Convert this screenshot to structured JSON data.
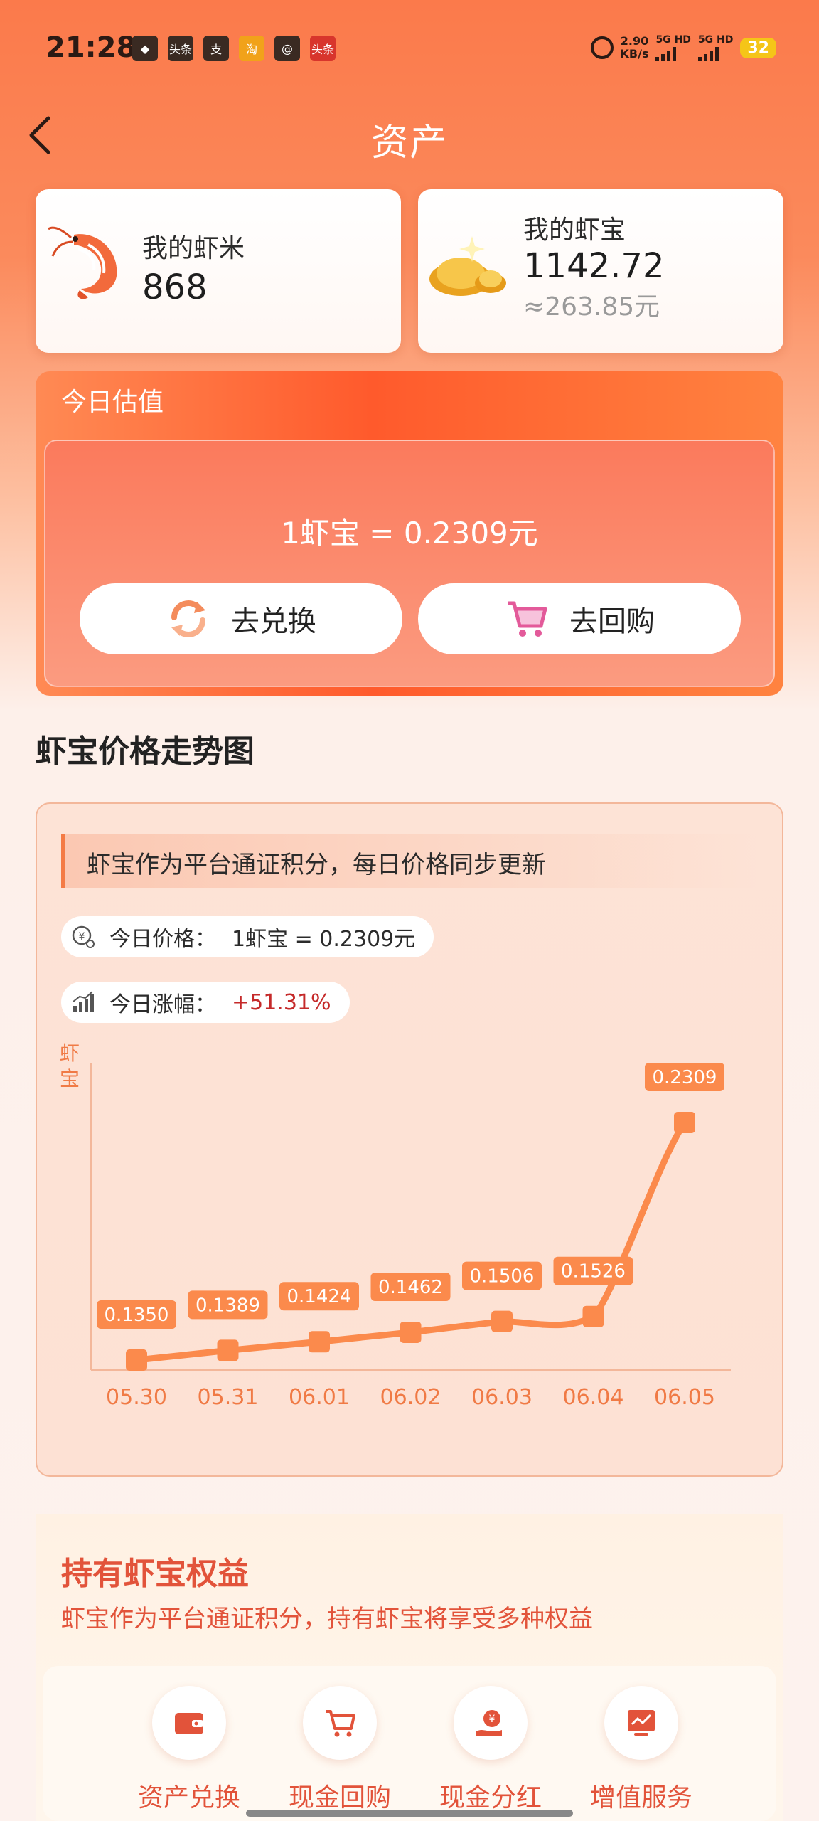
{
  "status_bar": {
    "time": "21:28",
    "apps": [
      "头条",
      "支",
      "淘",
      "@",
      "头条"
    ],
    "speed_value": "2.90",
    "speed_unit": "KB/s",
    "net1": "5G HD",
    "net2": "5G HD",
    "battery": "32"
  },
  "header": {
    "title": "资产"
  },
  "cards": {
    "shrimp": {
      "label": "我的虾米",
      "value": "868"
    },
    "treasure": {
      "label": "我的虾宝",
      "value": "1142.72",
      "sub": "≈263.85元"
    }
  },
  "valuation": {
    "tag": "今日估值",
    "rate": "1虾宝 = 0.2309元",
    "exchange_label": "去兑换",
    "buyback_label": "去回购"
  },
  "trend": {
    "section_title": "虾宝价格走势图",
    "notice": "虾宝作为平台通证积分，每日价格同步更新",
    "price_label": "今日价格：",
    "price_value": "1虾宝 = 0.2309元",
    "change_label": "今日涨幅：",
    "change_value": "+51.31%",
    "accent": "#f47b45",
    "up_color": "#c52a2a"
  },
  "chart_data": {
    "type": "line",
    "ylabel": "虾宝",
    "categories": [
      "05.30",
      "05.31",
      "06.01",
      "06.02",
      "06.03",
      "06.04",
      "06.05"
    ],
    "values": [
      0.135,
      0.1389,
      0.1424,
      0.1462,
      0.1506,
      0.1526,
      0.2309
    ],
    "labels": [
      "0.1350",
      "0.1389",
      "0.1424",
      "0.1462",
      "0.1506",
      "0.1526",
      "0.2309"
    ],
    "grid": false
  },
  "rights": {
    "title": "持有虾宝权益",
    "subtitle": "虾宝作为平台通证积分，持有虾宝将享受多种权益",
    "items": [
      {
        "label": "资产兑换",
        "icon": "wallet-icon"
      },
      {
        "label": "现金回购",
        "icon": "cart-icon"
      },
      {
        "label": "现金分红",
        "icon": "dividend-icon"
      },
      {
        "label": "增值服务",
        "icon": "chart-screen-icon"
      }
    ]
  }
}
